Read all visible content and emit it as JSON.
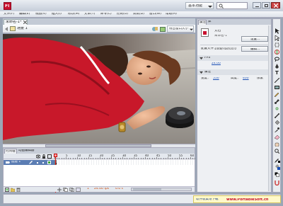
{
  "app": {
    "logo_letter": "Fl",
    "workspace": "基本功能",
    "search_placeholder": "",
    "accent": "#c8102e"
  },
  "menubar": {
    "items": [
      {
        "label": "文件(F)"
      },
      {
        "label": "编辑(E)"
      },
      {
        "label": "视图(V)"
      },
      {
        "label": "插入(I)"
      },
      {
        "label": "修改(M)"
      },
      {
        "label": "文本(T)"
      },
      {
        "label": "命令(C)"
      },
      {
        "label": "控制(O)"
      },
      {
        "label": "调试(D)"
      },
      {
        "label": "窗口(W)"
      },
      {
        "label": "帮助(H)"
      }
    ]
  },
  "document_tab": {
    "label": "未命名-1*"
  },
  "edit_bar": {
    "scene": "场景 1",
    "zoom_label": "符合窗口大小"
  },
  "properties": {
    "tabs": [
      {
        "label": "属性"
      },
      {
        "label": "库"
      }
    ],
    "doc_type": "文档",
    "doc_name": "未命名-1",
    "publish_button": "设置...",
    "profile_label": "配置文件：",
    "profile_value": "1448/Flash10.0",
    "edit_button": "编辑...",
    "section_label": "FPS",
    "fps": "24.00",
    "size_section": "属性",
    "width_label": "宽度：",
    "width_value": "550",
    "height_label": "高度：",
    "height_value": "400",
    "unit": "像素"
  },
  "timeline": {
    "tabs": [
      {
        "label": "时间轴"
      },
      {
        "label": "动画编辑器"
      }
    ],
    "layer_name": "图层 1",
    "frame_numbers": [
      "5",
      "10",
      "15",
      "20",
      "25",
      "30",
      "35",
      "40",
      "45",
      "50",
      "55",
      "60"
    ],
    "current_frame": "1",
    "fps_readout": "24.00 fps",
    "time_readout": "0.0 s"
  },
  "watermark": {
    "prefix": "软件收集与下载",
    "site": "www.PortableSoft.cn"
  }
}
